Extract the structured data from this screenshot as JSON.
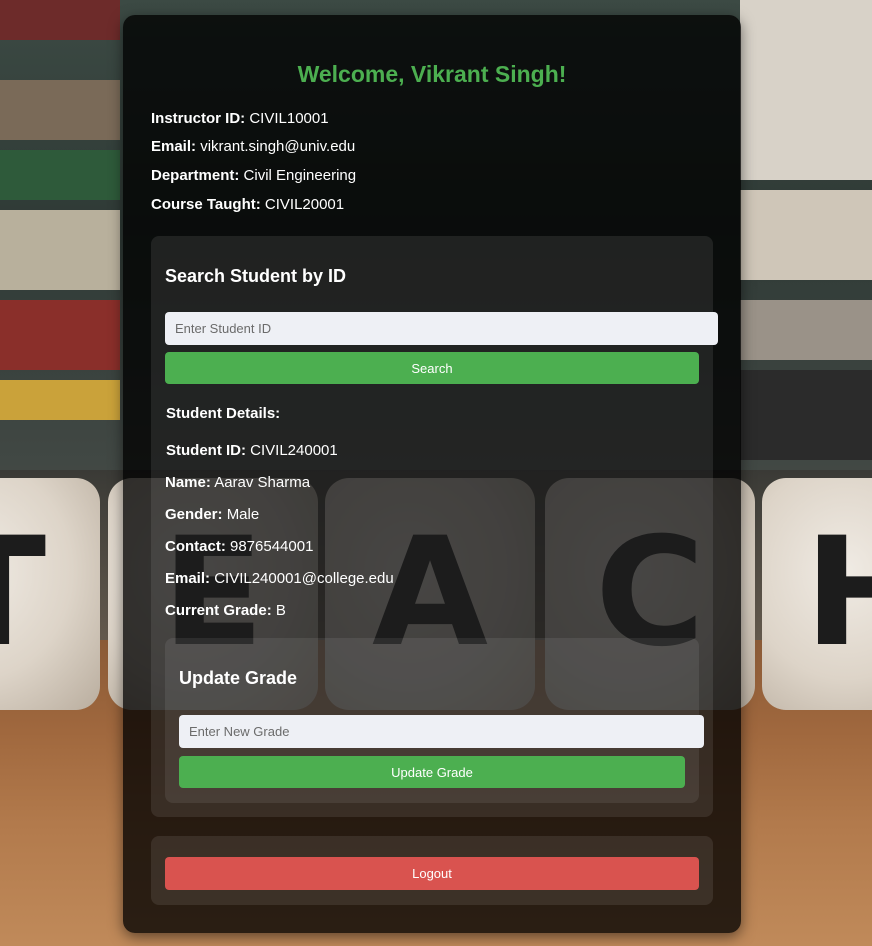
{
  "welcome": "Welcome, Vikrant Singh!",
  "instructor": {
    "id_label": "Instructor ID:",
    "id_value": "CIVIL10001",
    "email_label": "Email:",
    "email_value": "vikrant.singh@univ.edu",
    "department_label": "Department:",
    "department_value": "Civil Engineering",
    "course_label": "Course Taught:",
    "course_value": "CIVIL20001"
  },
  "search": {
    "title": "Search Student by ID",
    "placeholder": "Enter Student ID",
    "button_label": "Search"
  },
  "student": {
    "heading": "Student Details:",
    "id_label": "Student ID:",
    "id_value": "CIVIL240001",
    "name_label": "Name:",
    "name_value": "Aarav Sharma",
    "gender_label": "Gender:",
    "gender_value": "Male",
    "contact_label": "Contact:",
    "contact_value": "9876544001",
    "email_label": "Email:",
    "email_value": "CIVIL240001@college.edu",
    "grade_label": "Current Grade:",
    "grade_value": "B"
  },
  "update": {
    "title": "Update Grade",
    "placeholder": "Enter New Grade",
    "button_label": "Update Grade"
  },
  "logout": {
    "button_label": "Logout"
  },
  "background": {
    "letters": [
      "T",
      "E",
      "A",
      "C",
      "H"
    ]
  },
  "colors": {
    "accent_green": "#4caf50",
    "logout_red": "#d9534f"
  }
}
